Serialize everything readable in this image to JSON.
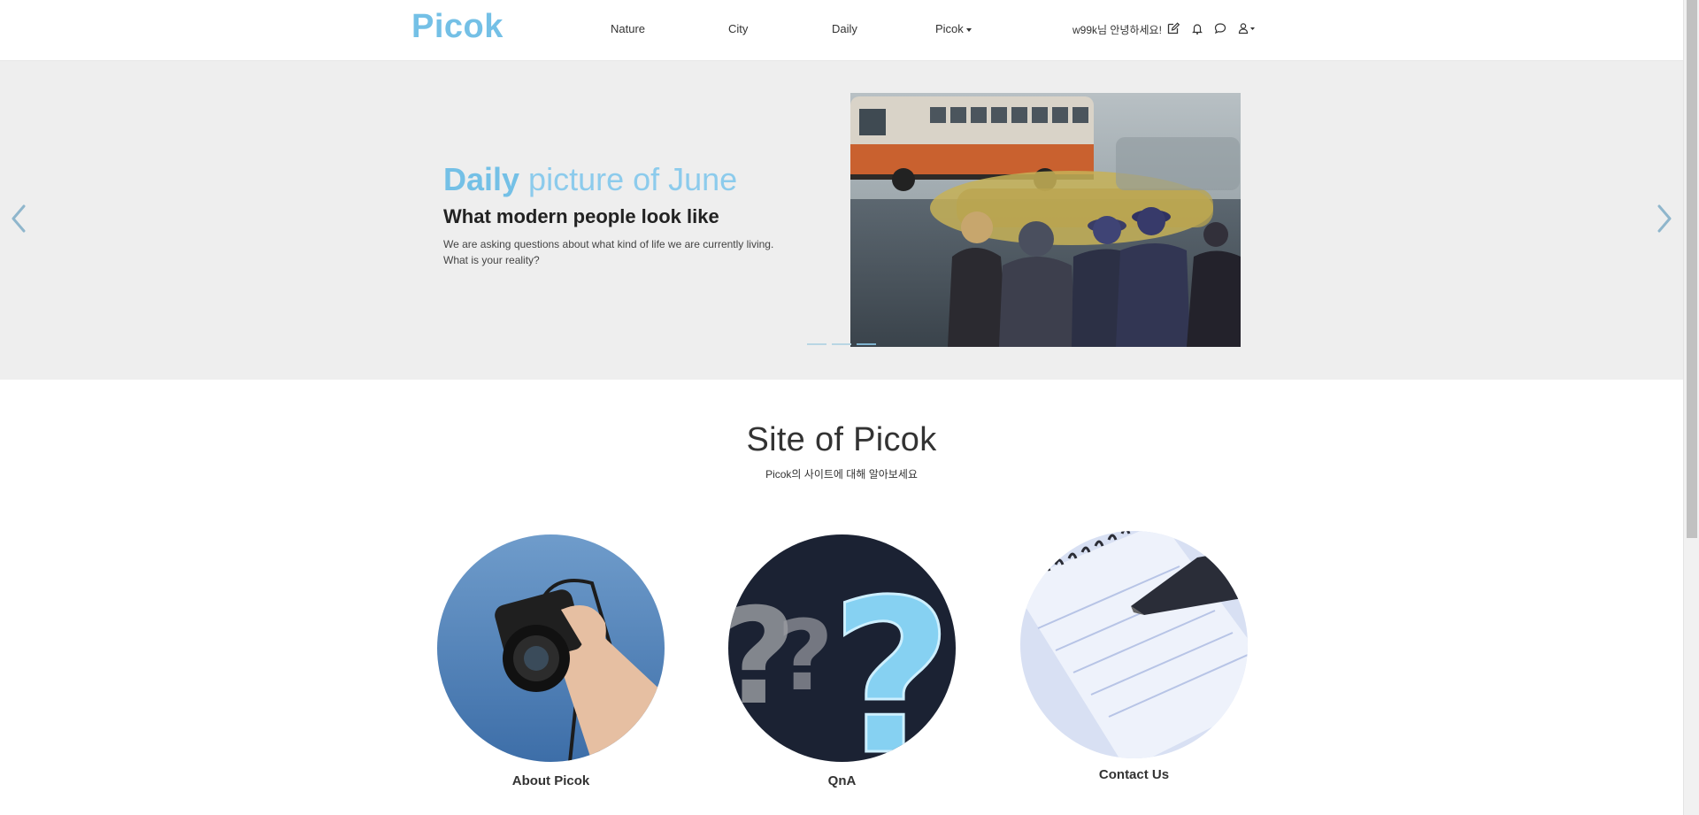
{
  "nav": {
    "brand": "Picok",
    "links": [
      "Nature",
      "City",
      "Daily"
    ],
    "dropdown_label": "Picok",
    "greeting": "w99k님 안녕하세요!",
    "icons": [
      "edit-icon",
      "bell-icon",
      "chat-icon",
      "user-icon"
    ]
  },
  "hero": {
    "title_strong": "Daily",
    "title_rest": " picture of June",
    "subtitle": "What modern people look like",
    "desc_line1": "We are asking questions about what kind of life we are currently living.",
    "desc_line2": "What is your reality?",
    "slide_count": 3,
    "active_slide": 3
  },
  "section": {
    "title": "Site of Picok",
    "subtitle": "Picok의 사이트에 대해 알아보세요"
  },
  "cards": [
    {
      "label": "About Picok",
      "image": "camera-photo"
    },
    {
      "label": "QnA",
      "image": "question-marks-photo"
    },
    {
      "label": "Contact Us",
      "image": "notepad-photo"
    }
  ],
  "colors": {
    "brand": "#74c0e6",
    "hero_bg": "#eeeeee",
    "arrow": "#8fb6cc"
  }
}
